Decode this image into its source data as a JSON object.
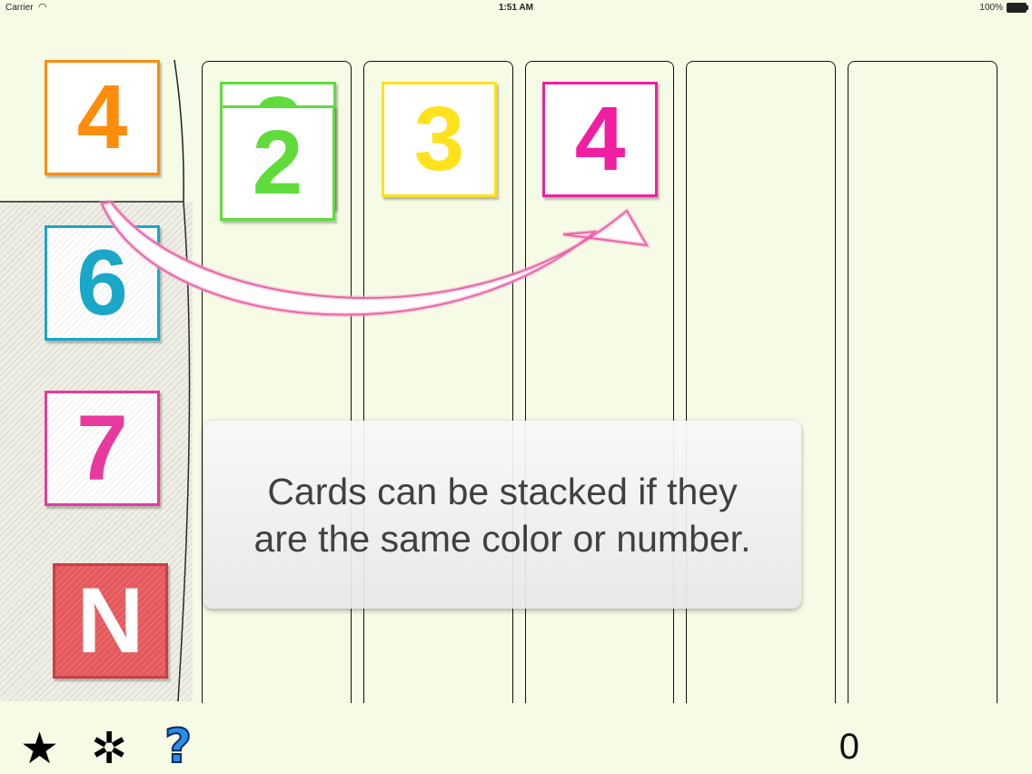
{
  "status_bar": {
    "carrier": "Carrier",
    "time": "1:51 AM",
    "battery": "100%"
  },
  "draw_card": {
    "label": "4",
    "color": "#ff8c0a"
  },
  "hand_cards": [
    {
      "label": "6",
      "color": "#1aa7c8"
    },
    {
      "label": "7",
      "color": "#e83a9e"
    },
    {
      "label": "N",
      "color": "#e5585c"
    }
  ],
  "columns": [
    {
      "cards": [
        {
          "label": "2",
          "color": "#5fdc3c"
        },
        {
          "label": "2",
          "color": "#5fdc3c"
        }
      ]
    },
    {
      "cards": [
        {
          "label": "3",
          "color": "#ffe21c"
        }
      ]
    },
    {
      "cards": [
        {
          "label": "4",
          "color": "#f01ea0"
        }
      ]
    },
    {
      "cards": []
    },
    {
      "cards": []
    }
  ],
  "tutorial": {
    "message": "Cards can be stacked if they are the same color or number."
  },
  "toolbar": {
    "star_icon": "★",
    "settings_icon": "✲",
    "help_icon": "?"
  },
  "score": "0"
}
